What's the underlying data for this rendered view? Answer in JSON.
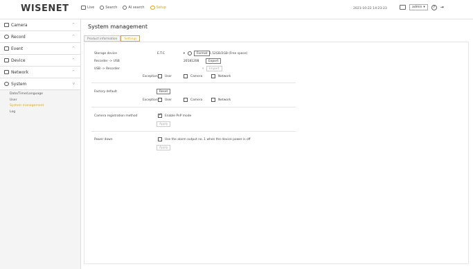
{
  "header": {
    "logo": "WISENET",
    "nav": [
      {
        "label": "Live",
        "icon": "monitor-icon"
      },
      {
        "label": "Search",
        "icon": "search-icon"
      },
      {
        "label": "AI search",
        "icon": "ai-search-icon"
      },
      {
        "label": "Setup",
        "icon": "setup-icon"
      }
    ],
    "datetime": "2021-10-22 14:23:23",
    "user": "admin",
    "user_icon": "user-icon",
    "help_icon": "help-icon",
    "logout_icon": "logout-icon"
  },
  "sidebar": {
    "items": [
      {
        "label": "Camera",
        "icon": "camera-icon",
        "chevron": "^"
      },
      {
        "label": "Record",
        "icon": "record-icon",
        "chevron": "^"
      },
      {
        "label": "Event",
        "icon": "event-icon",
        "chevron": "^"
      },
      {
        "label": "Device",
        "icon": "device-icon",
        "chevron": "^"
      },
      {
        "label": "Network",
        "icon": "network-icon",
        "chevron": "^"
      },
      {
        "label": "System",
        "icon": "system-icon",
        "chevron": "v"
      }
    ],
    "submenu": [
      "Date/Time/Language",
      "User",
      "System management",
      "Log"
    ],
    "active_submenu": "System management"
  },
  "main": {
    "title": "System management",
    "tabs": [
      "Product information",
      "Settings"
    ],
    "active_tab": "Settings",
    "settings": {
      "storage_device_label": "Storage device",
      "storage_device_value": "E.T.C",
      "format_label": "Format",
      "storage_info": "1.52GB/2GB (Free space)",
      "recorder_usb_label": "Recorder -> USB",
      "recorder_usb_value": "20181208",
      "export_label": "Export",
      "usb_recorder_label": "USB -> Recorder",
      "import_label": "Import",
      "exception_label": "Exception",
      "exception_opts": [
        "User",
        "Camera",
        "Network"
      ],
      "factory_default_label": "Factory default",
      "reset_label": "Reset",
      "camera_reg_label": "Camera registration method",
      "pnp_label": "Enable PnP mode",
      "apply_label": "Apply",
      "power_down_label": "Power down",
      "power_down_text": "Use the alarm output no. 1 when the device power is off"
    }
  }
}
